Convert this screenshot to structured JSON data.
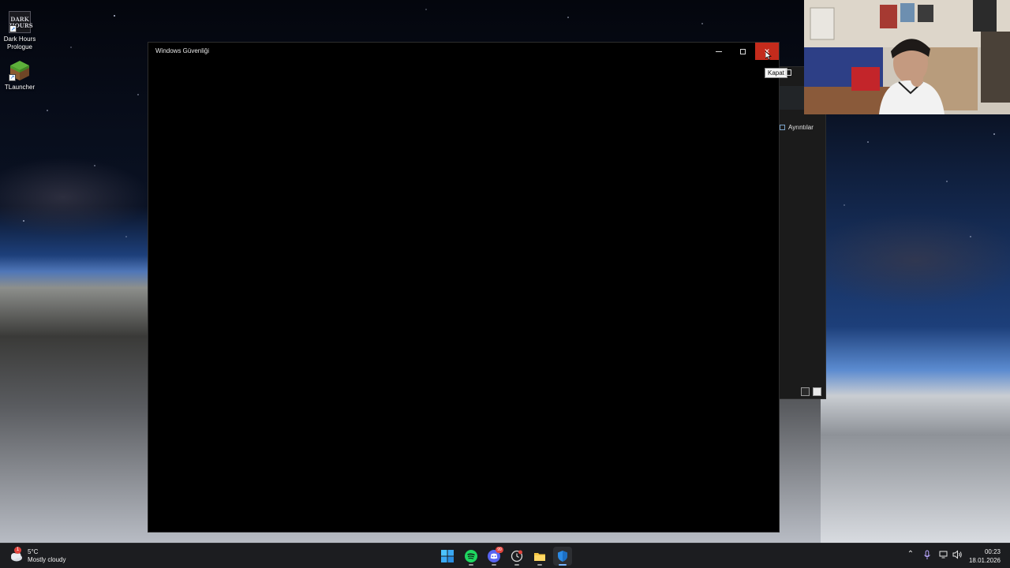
{
  "desktop": {
    "icons": [
      {
        "label_line1": "Dark Hours",
        "label_line2": "Prologue",
        "glyph_text": "DARK\nHOURS"
      },
      {
        "label": "TLauncher"
      }
    ]
  },
  "main_window": {
    "title": "Windows Güvenliği",
    "close_tooltip": "Kapat"
  },
  "background_window": {
    "details_label": "Ayrıntılar"
  },
  "taskbar": {
    "weather": {
      "temperature": "5°C",
      "condition": "Mostly cloudy",
      "badge": "1"
    },
    "apps": [
      {
        "name": "start"
      },
      {
        "name": "spotify"
      },
      {
        "name": "discord",
        "badge": "99"
      },
      {
        "name": "clock-app"
      },
      {
        "name": "file-explorer"
      },
      {
        "name": "windows-security",
        "active": true
      }
    ],
    "clock": {
      "time": "00:23",
      "date": "18.01.2026"
    }
  },
  "colors": {
    "close_red": "#c42b1c",
    "taskbar": "#1c1d20",
    "active_indicator": "#7ab6ff"
  }
}
